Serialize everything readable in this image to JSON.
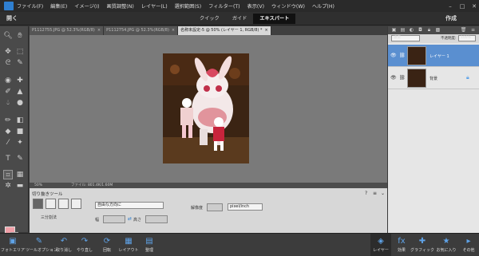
{
  "menubar": {
    "items": [
      "ファイル(F)",
      "編集(E)",
      "イメージ(I)",
      "画質調整(N)",
      "レイヤー(L)",
      "選択範囲(S)",
      "フィルター(T)",
      "表示(V)",
      "ウィンドウ(W)",
      "ヘルプ(H)"
    ]
  },
  "modebar": {
    "open_label": "開く",
    "tabs": [
      "クイック",
      "ガイド",
      "エキスパート"
    ],
    "active_tab": "エキスパート",
    "create_label": "作成"
  },
  "doc_tabs": [
    {
      "label": "P1112755.JPG @ 52.3%(RGB/8)",
      "close": "×"
    },
    {
      "label": "P1112754.JPG @ 52.3%(RGB/8)",
      "close": "×"
    },
    {
      "label": "名称未設定-5 @ 50% (レイヤー 1, RGB/8) *",
      "close": "×"
    }
  ],
  "status": {
    "zoom": "50%",
    "doc_size": "ファイル: 801.4K/1.60M"
  },
  "tool_options": {
    "title": "切り抜きツール",
    "grid_label": "三分割法",
    "ratio_value": "自由な方向に",
    "width_label": "幅",
    "height_label": "高さ",
    "resolution_label": "解像度",
    "unit_value": "pixel/inch"
  },
  "layers_panel": {
    "blend_mode": "通常",
    "opacity_label": "不透明度:",
    "opacity_value": "100%",
    "layers": [
      {
        "name": "レイヤー 1",
        "selected": true
      },
      {
        "name": "背景",
        "selected": false
      }
    ]
  },
  "bottom_bar": {
    "left": [
      "フォトエリア",
      "ツールオプション",
      "取り消し",
      "やり直し",
      "回転",
      "レイアウト",
      "整理"
    ],
    "right": [
      "レイヤー",
      "効果",
      "グラフィック",
      "お気に入り",
      "その他"
    ]
  },
  "colors": {
    "foreground": "#f0a0a8",
    "background": "#ffffff",
    "accent": "#5a8fd0"
  }
}
